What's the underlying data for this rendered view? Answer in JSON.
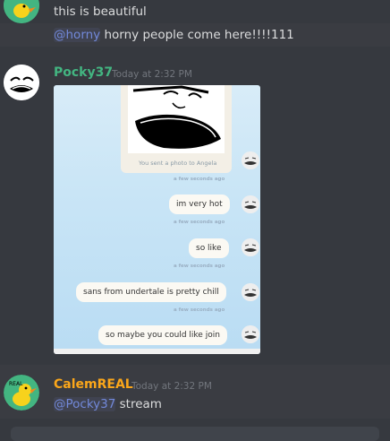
{
  "messages": {
    "first": {
      "line1": "this is beautiful",
      "line2_mention": "@horny",
      "line2_text": " horny people come here!!!!111"
    },
    "pocky": {
      "username": "Pocky37",
      "username_color": "#43b581",
      "timestamp": "Today at 2:32 PM",
      "embed": {
        "photo_caption": "You sent a photo to Angela",
        "items": [
          {
            "ago": "a few seconds ago",
            "text": "im very hot"
          },
          {
            "ago": "a few seconds ago",
            "text": "so like"
          },
          {
            "ago": "a few seconds ago",
            "text": "sans from undertale is pretty chill"
          },
          {
            "ago": "a few seconds ago",
            "text": "so maybe you could like join"
          }
        ],
        "first_ago": "a few seconds ago"
      }
    },
    "calem": {
      "username": "CalemREAL",
      "username_color": "#faa61a",
      "timestamp": "Today at 2:32 PM",
      "mention": "@Pocky37",
      "text": " stream",
      "avatar_label": "REAL"
    }
  },
  "colors": {
    "background": "#36393f",
    "mention": "#7289da",
    "duck_green": "#43b581",
    "duck_yellow": "#f7d21c"
  }
}
